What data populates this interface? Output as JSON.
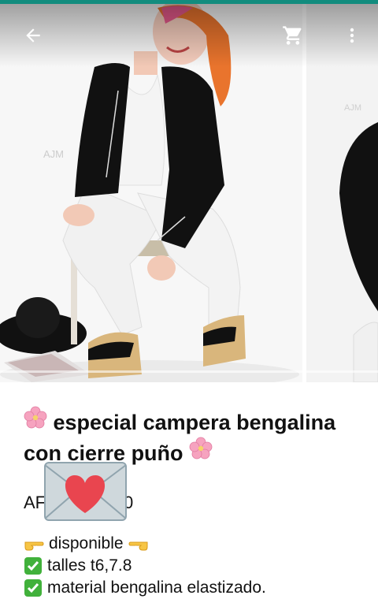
{
  "header": {
    "back_icon": "arrow-left-icon",
    "cart_icon": "cart-icon",
    "menu_icon": "more-vert-icon"
  },
  "product": {
    "title_line1": "especial campera bengalina",
    "title_line2": "con cierre puño",
    "price_left": "AF",
    "price_right": "0",
    "details": [
      {
        "icon": "pointing-hand-icon",
        "text": "disponible"
      },
      {
        "icon": "check-mark-icon",
        "text": "talles t6,7.8"
      },
      {
        "icon": "check-mark-icon",
        "text": "material bengalina elastizado."
      }
    ],
    "watermark": "AJM"
  },
  "colors": {
    "accent": "#128c7e",
    "check_green": "#41b13b",
    "heart_red": "#e9454f",
    "flower_pink": "#f6a3bf"
  }
}
